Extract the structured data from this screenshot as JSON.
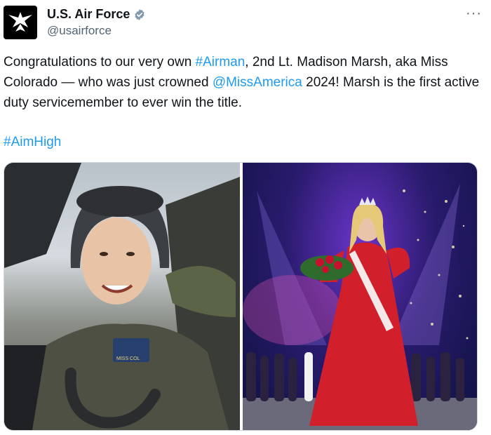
{
  "account": {
    "name": "U.S. Air Force",
    "handle": "@usairforce",
    "verified_icon": "verified-badge-icon",
    "avatar_icon": "air-force-wings-logo"
  },
  "menu": {
    "more_label": "···"
  },
  "tweet": {
    "part1": "Congratulations to our very own ",
    "hashtag_airman": "#Airman",
    "part2": ", 2nd Lt. Madison Marsh, aka Miss Colorado — who was just crowned ",
    "mention": "@MissAmerica",
    "part3": " 2024! Marsh is the first active duty servicemember to ever win the title.",
    "hashtag_aimhigh": "#AimHigh"
  },
  "media": {
    "left_photo": "pilot-portrait",
    "right_photo": "miss-america-crowning",
    "name_patch_text": "MISS COL"
  },
  "colors": {
    "link": "#1d9bf0",
    "verified": "#829aab",
    "text": "#0f1419",
    "muted": "#536471"
  }
}
